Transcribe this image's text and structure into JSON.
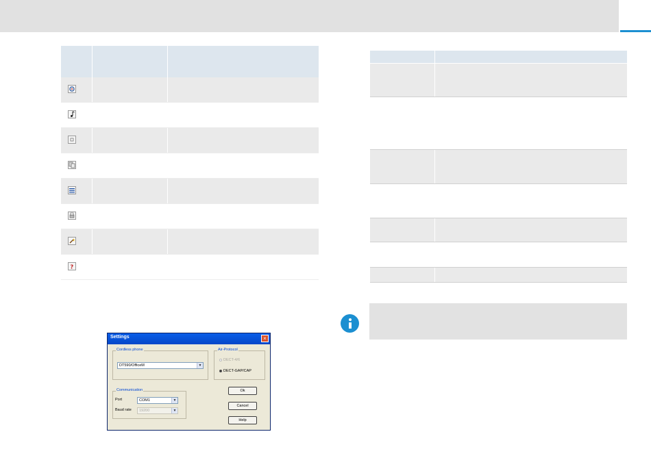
{
  "icon_table": {
    "rows": [
      {
        "icon": "settings-icon",
        "shaded": true
      },
      {
        "icon": "music-note-icon",
        "shaded": false
      },
      {
        "icon": "blank-window-icon",
        "shaded": true
      },
      {
        "icon": "copy-document-icon",
        "shaded": false
      },
      {
        "icon": "list-icon",
        "shaded": true
      },
      {
        "icon": "printer-icon",
        "shaded": false
      },
      {
        "icon": "wizard-icon",
        "shaded": true
      },
      {
        "icon": "help-icon",
        "shaded": false
      }
    ]
  },
  "dialog": {
    "title": "Settings",
    "cordless_phone_label": "Cordless phone",
    "phone_model": "DT590/OfficeM",
    "air_protocol_label": "Air-Protocol",
    "protocol_options": [
      "DECT-4/6",
      "DECT-GAP/CAP"
    ],
    "selected_protocol": "DECT-GAP/CAP",
    "communication_label": "Communication",
    "port_label": "Port",
    "port_value": "COM1",
    "baud_label": "Baud rate",
    "baud_value": "19200",
    "ok_label": "Ok",
    "cancel_label": "Cancel",
    "help_label": "Help"
  },
  "colors": {
    "accent": "#1b8fd1",
    "header_fill": "#dde6ee",
    "row_shade": "#eaeaea"
  }
}
